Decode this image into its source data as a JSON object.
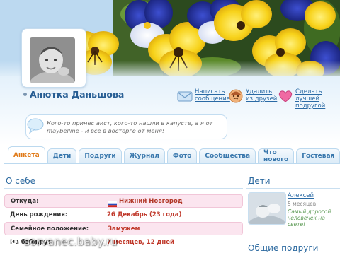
{
  "profile": {
    "name": "Анютка Даньшова",
    "status_text": "Кого-то принес аист, кого-то нашли в капусте, а я от maybelline - и все в восторге от меня!"
  },
  "actions": [
    {
      "label": "Написать сообщение",
      "icon": "envelope-icon"
    },
    {
      "label": "Удалить из друзей",
      "icon": "remove-friend-icon"
    },
    {
      "label": "Сделать лучшей подругой",
      "icon": "heart-icon"
    }
  ],
  "tabs": [
    {
      "label": "Анкета",
      "active": true
    },
    {
      "label": "Дети"
    },
    {
      "label": "Подруги"
    },
    {
      "label": "Журнал"
    },
    {
      "label": "Фото"
    },
    {
      "label": "Сообщества"
    },
    {
      "label": "Что нового"
    },
    {
      "label": "Гостевая"
    }
  ],
  "about": {
    "title": "О себе",
    "rows": [
      {
        "key": "Откуда:",
        "value": "Нижний Новгород"
      },
      {
        "key": "День рождения:",
        "value": "26 Декабрь (23 года)"
      },
      {
        "key": "Семейное положение:",
        "value": "Замужем"
      },
      {
        "key": "На бэби.ру:",
        "value": "7 месяцев, 12 дней"
      }
    ]
  },
  "children": {
    "title": "Дети",
    "items": [
      {
        "name": "Алексей",
        "age": "5 месяцев",
        "note": "Самый дорогой человечек на свете!"
      }
    ]
  },
  "friends": {
    "title": "Общие подруги"
  },
  "watermark": {
    "text": "sorvanec.baby.ru"
  },
  "colors": {
    "link": "#2a6aa5",
    "active_tab": "#e07a18",
    "value_red": "#c0392b",
    "row_pink": "#fbe5ef"
  }
}
